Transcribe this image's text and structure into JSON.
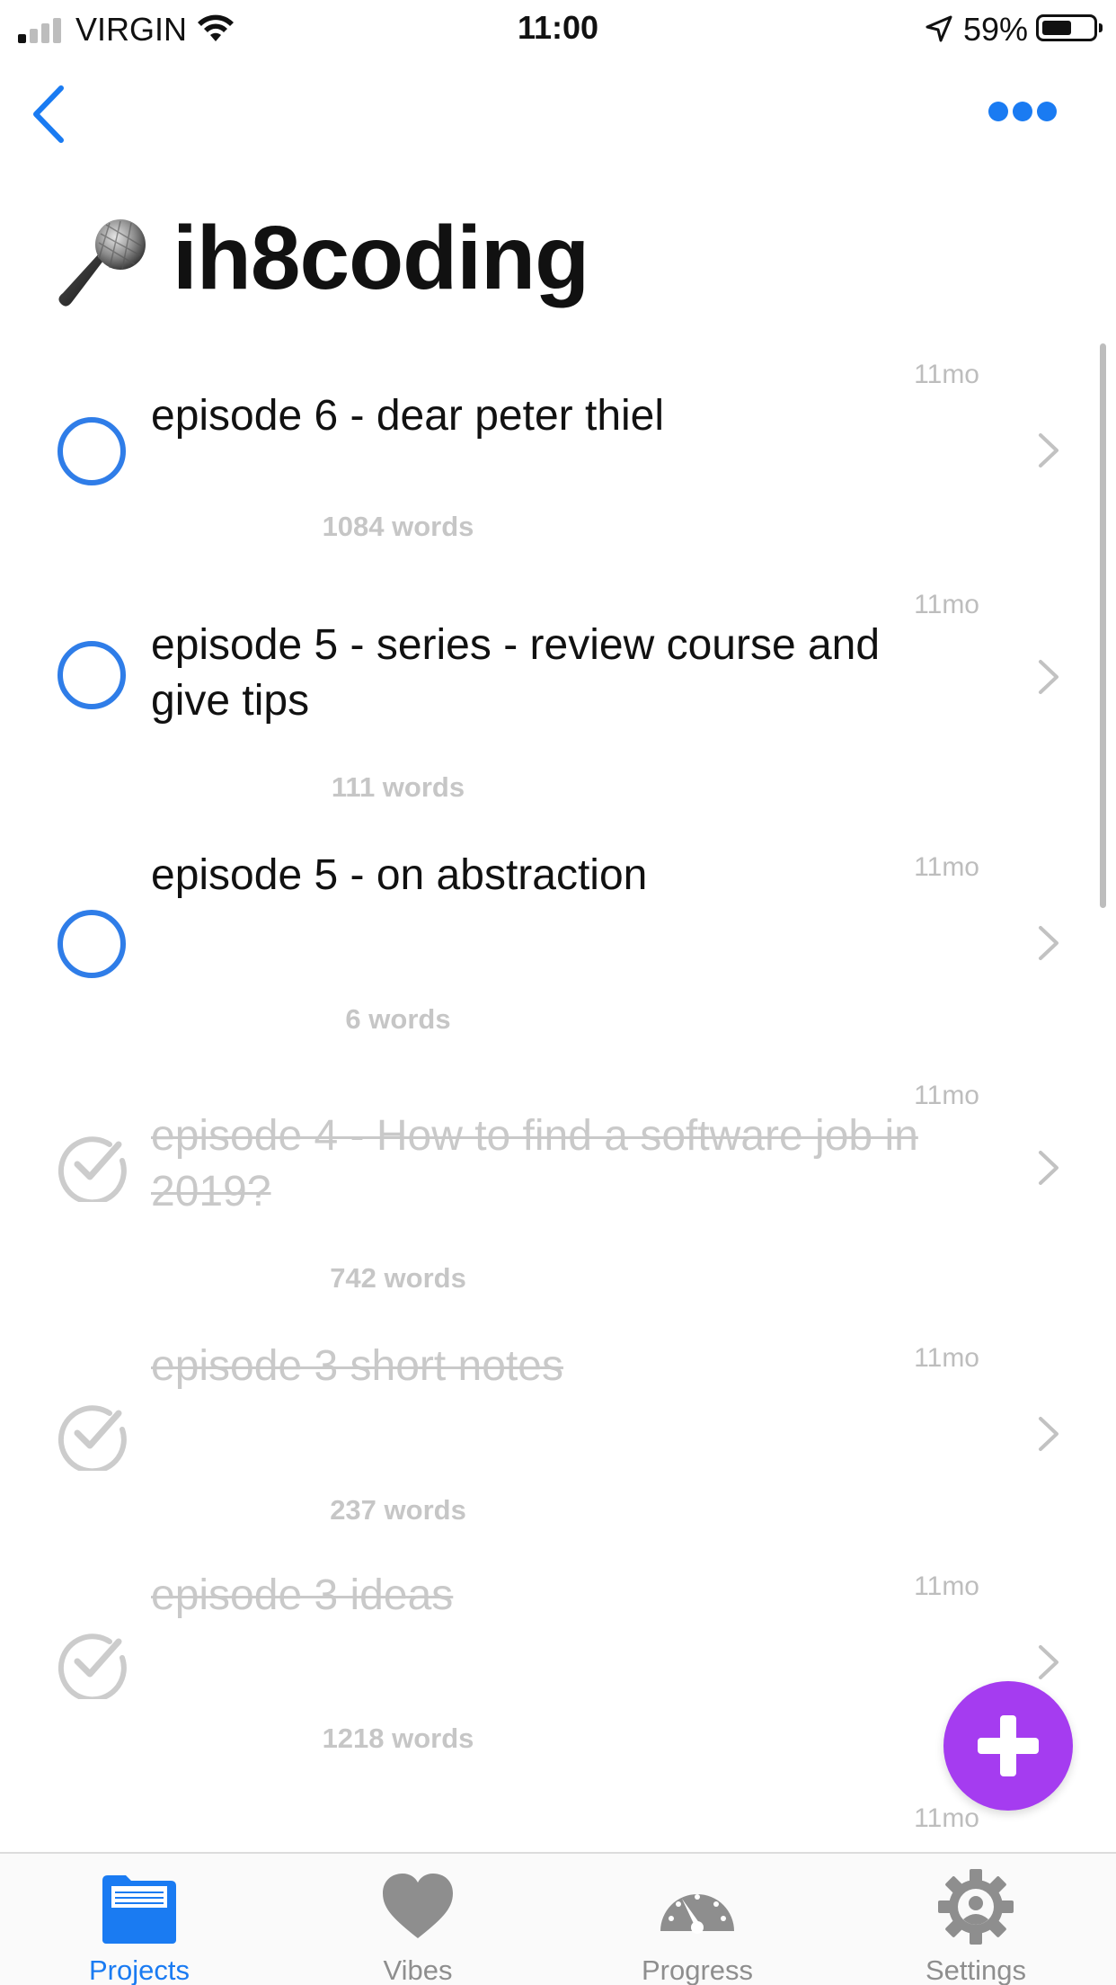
{
  "status_bar": {
    "carrier": "VIRGIN",
    "time": "11:00",
    "battery_percent": "59%",
    "battery_level": 0.59,
    "signal_bars_filled": 1,
    "signal_bars_total": 4
  },
  "nav": {
    "back_icon": "chevron-left-icon",
    "more_icon": "ellipsis-icon"
  },
  "project": {
    "emoji_icon": "microphone-icon",
    "title": "ih8coding"
  },
  "items": [
    {
      "title": "episode 6 - dear peter thiel",
      "age": "11mo",
      "words": "1084 words",
      "done": false
    },
    {
      "title": "episode 5 - series - review course and give tips",
      "age": "11mo",
      "words": "111 words",
      "done": false
    },
    {
      "title": "episode 5 - on abstraction",
      "age": "11mo",
      "words": "6 words",
      "done": false
    },
    {
      "title": "episode 4 - How to find a software job in 2019?",
      "age": "11mo",
      "words": "742 words",
      "done": true
    },
    {
      "title": "episode 3 short notes",
      "age": "11mo",
      "words": "237 words",
      "done": true
    },
    {
      "title": "episode 3 ideas",
      "age": "11mo",
      "words": "1218 words",
      "done": true
    }
  ],
  "trailing_age": "11mo",
  "fab": {
    "icon": "plus-icon"
  },
  "tabs": [
    {
      "label": "Projects",
      "icon": "folder-icon",
      "active": true
    },
    {
      "label": "Vibes",
      "icon": "heart-icon",
      "active": false
    },
    {
      "label": "Progress",
      "icon": "gauge-icon",
      "active": false
    },
    {
      "label": "Settings",
      "icon": "gear-icon",
      "active": false
    }
  ],
  "colors": {
    "accent": "#1a7bf2",
    "fab": "#a53cf0",
    "done_text": "#c9c9c9",
    "open_circle": "#2f7de8"
  }
}
